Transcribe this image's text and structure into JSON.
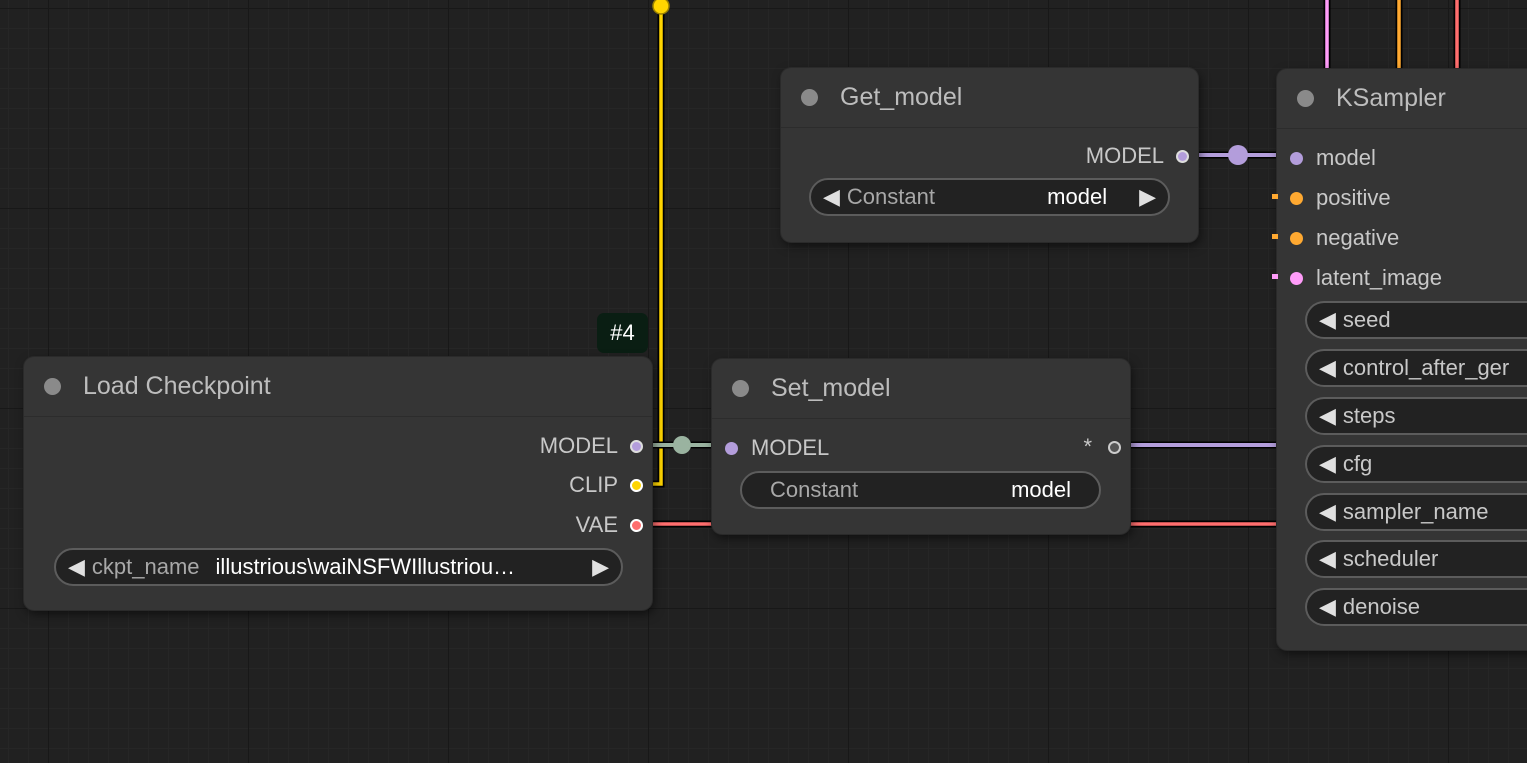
{
  "colors": {
    "model": "#b39ddb",
    "clip": "#ffd500",
    "vae": "#ff6e6e",
    "conditioning": "#ffa931",
    "latent": "#ff9cf9",
    "reroute": "#9ab3a0"
  },
  "badge": "#4",
  "load_checkpoint": {
    "title": "Load Checkpoint",
    "outputs": {
      "model": "MODEL",
      "clip": "CLIP",
      "vae": "VAE"
    },
    "widget": {
      "label": "ckpt_name",
      "value": "illustrious\\waiNSFWIllustriou…"
    }
  },
  "set_model": {
    "title": "Set_model",
    "input": "MODEL",
    "output": "*",
    "widget": {
      "label": "Constant",
      "value": "model"
    }
  },
  "get_model": {
    "title": "Get_model",
    "output": "MODEL",
    "widget": {
      "label": "Constant",
      "value": "model"
    }
  },
  "ksampler": {
    "title": "KSampler",
    "inputs": {
      "model": "model",
      "positive": "positive",
      "negative": "negative",
      "latent_image": "latent_image"
    },
    "widgets": {
      "seed": "seed",
      "control_after_generate": "control_after_ger",
      "steps": "steps",
      "cfg": "cfg",
      "sampler_name": "sampler_name",
      "scheduler": "scheduler",
      "denoise": "denoise"
    }
  },
  "icons": {
    "left_arrow": "◀",
    "right_arrow": "▶"
  }
}
